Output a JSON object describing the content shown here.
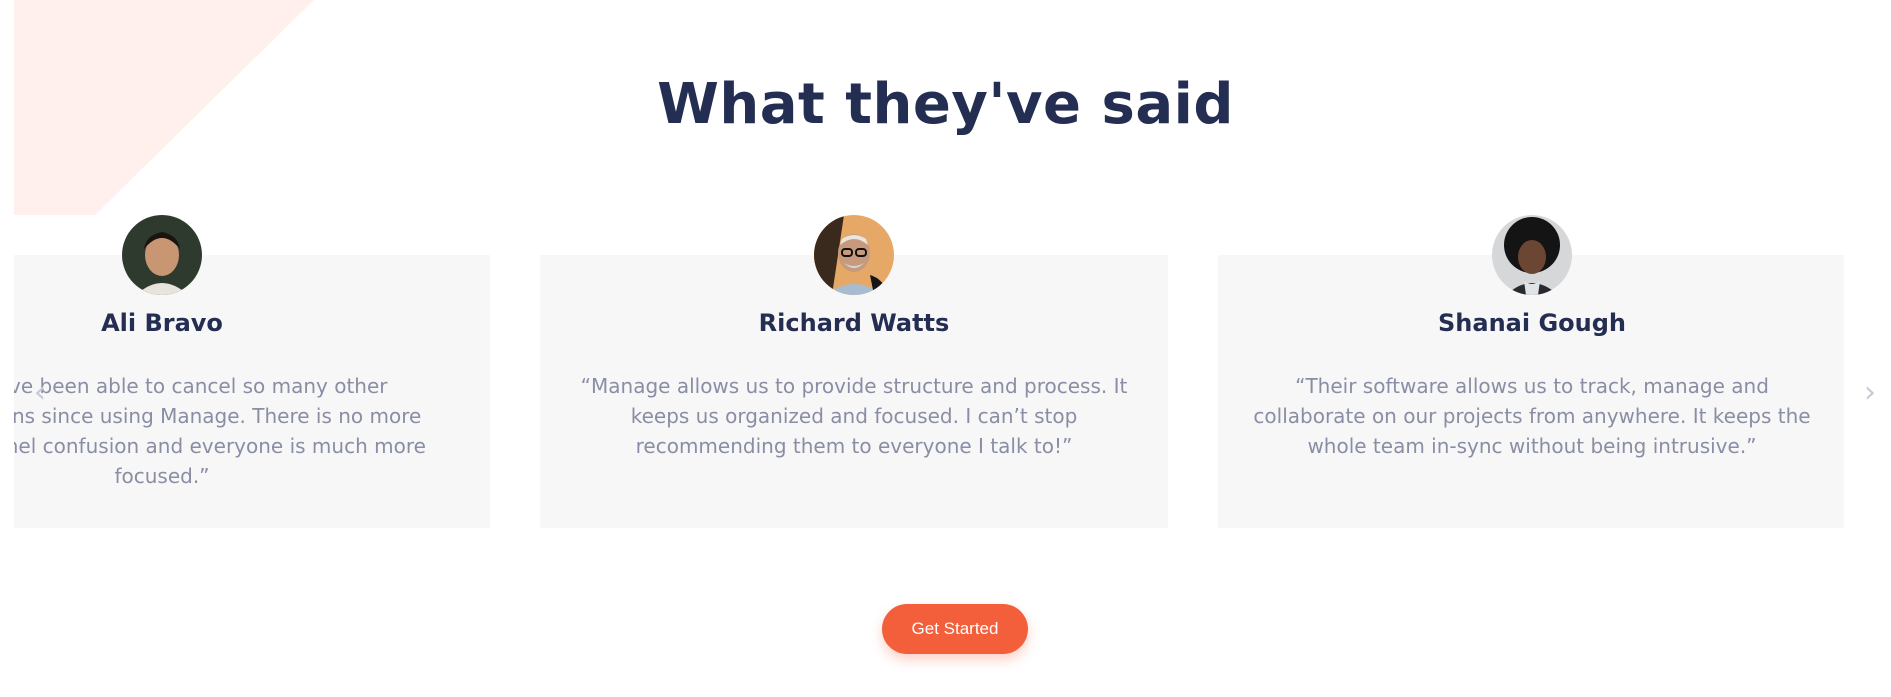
{
  "section": {
    "title": "What they've said"
  },
  "testimonials": [
    {
      "name": "Ali Bravo",
      "avatar_icon": "person-avatar-icon",
      "quote_lines": [
        "“We have been able to cancel so many other",
        "subscriptions since using Manage. There is no more",
        "cross-channel confusion and everyone is much more",
        "focused.”"
      ]
    },
    {
      "name": "Richard Watts",
      "avatar_icon": "person-avatar-icon",
      "quote_lines": [
        "“Manage allows us to provide structure and process. It",
        "keeps us organized and focused. I can’t stop",
        "recommending them to everyone I talk to!”"
      ]
    },
    {
      "name": "Shanai Gough",
      "avatar_icon": "person-avatar-icon",
      "quote_lines": [
        "“Their software allows us to track, manage and",
        "collaborate on our projects from anywhere. It keeps the",
        "whole team in-sync without being intrusive.”"
      ]
    }
  ],
  "carousel": {
    "prev_icon": "chevron-left-icon",
    "next_icon": "chevron-right-icon"
  },
  "cta": {
    "label": "Get Started"
  },
  "colors": {
    "heading": "#242d52",
    "body_text": "#8a8ea4",
    "card_bg": "#f7f7f8",
    "accent": "#f25f3a",
    "decor": "#fff0ed"
  }
}
